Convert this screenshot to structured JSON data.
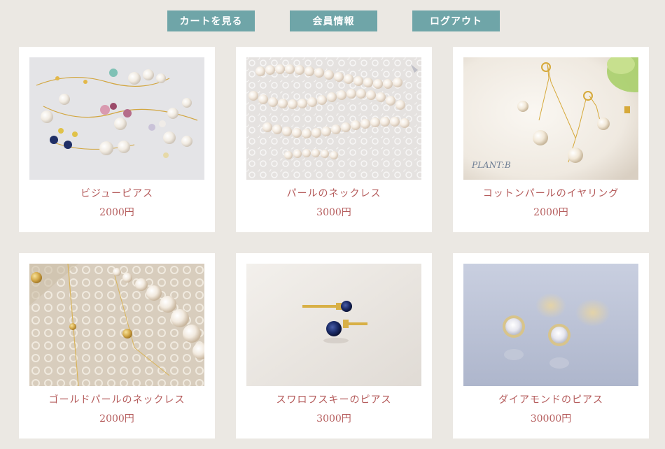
{
  "nav": {
    "cart_label": "カートを見る",
    "member_label": "会員情報",
    "logout_label": "ログアウト"
  },
  "products": [
    {
      "name": "ビジューピアス",
      "price": "2000円",
      "photo": "bijou-earrings-photo"
    },
    {
      "name": "パールのネックレス",
      "price": "3000円",
      "photo": "pearl-necklace-photo"
    },
    {
      "name": "コットンパールのイヤリング",
      "price": "2000円",
      "photo": "cotton-pearl-earrings-photo",
      "watermark": "PLANT:B"
    },
    {
      "name": "ゴールドパールのネックレス",
      "price": "2000円",
      "photo": "gold-pearl-necklace-photo"
    },
    {
      "name": "スワロフスキーのピアス",
      "price": "3000円",
      "photo": "swarovski-earrings-photo"
    },
    {
      "name": "ダイアモンドのピアス",
      "price": "30000円",
      "photo": "diamond-earrings-photo"
    }
  ],
  "colors": {
    "background": "#ebe8e3",
    "nav_button": "#6fa5a8",
    "product_text": "#b55c5c"
  }
}
